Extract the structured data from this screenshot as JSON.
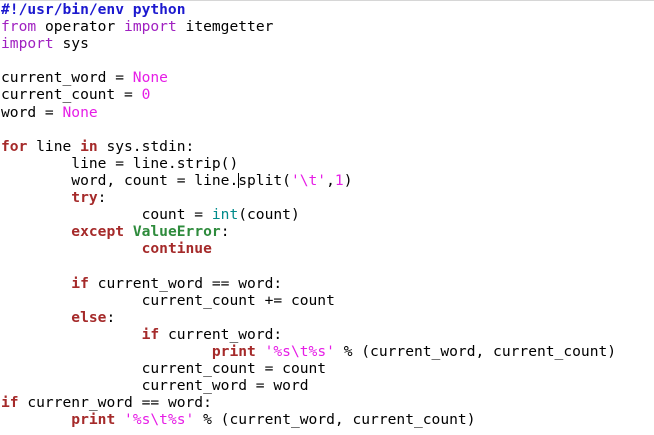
{
  "editor": {
    "lines": [
      [
        {
          "t": "#!/usr/bin/env python",
          "c": "shebang"
        }
      ],
      [
        {
          "t": "from",
          "c": "preproc"
        },
        {
          "t": " operator ",
          "c": "plain"
        },
        {
          "t": "import",
          "c": "preproc"
        },
        {
          "t": " itemgetter",
          "c": "plain"
        }
      ],
      [
        {
          "t": "import",
          "c": "preproc"
        },
        {
          "t": " sys",
          "c": "plain"
        }
      ],
      [],
      [
        {
          "t": "current_word = ",
          "c": "plain"
        },
        {
          "t": "None",
          "c": "const"
        }
      ],
      [
        {
          "t": "current_count = ",
          "c": "plain"
        },
        {
          "t": "0",
          "c": "const"
        }
      ],
      [
        {
          "t": "word = ",
          "c": "plain"
        },
        {
          "t": "None",
          "c": "const"
        }
      ],
      [],
      [
        {
          "t": "for",
          "c": "kw"
        },
        {
          "t": " line ",
          "c": "plain"
        },
        {
          "t": "in",
          "c": "kw"
        },
        {
          "t": " sys.stdin:",
          "c": "plain"
        }
      ],
      [
        {
          "t": "        line = line.strip()",
          "c": "plain"
        }
      ],
      [
        {
          "t": "        word, count = line.",
          "c": "plain"
        },
        {
          "t": "",
          "c": "cursor"
        },
        {
          "t": "split(",
          "c": "plain"
        },
        {
          "t": "'\\t'",
          "c": "const"
        },
        {
          "t": ",",
          "c": "plain"
        },
        {
          "t": "1",
          "c": "const"
        },
        {
          "t": ")",
          "c": "plain"
        }
      ],
      [
        {
          "t": "        ",
          "c": "plain"
        },
        {
          "t": "try",
          "c": "kw"
        },
        {
          "t": ":",
          "c": "plain"
        }
      ],
      [
        {
          "t": "                count = ",
          "c": "plain"
        },
        {
          "t": "int",
          "c": "builtin"
        },
        {
          "t": "(count)",
          "c": "plain"
        }
      ],
      [
        {
          "t": "        ",
          "c": "plain"
        },
        {
          "t": "except",
          "c": "kw"
        },
        {
          "t": " ",
          "c": "plain"
        },
        {
          "t": "ValueError",
          "c": "exc"
        },
        {
          "t": ":",
          "c": "plain"
        }
      ],
      [
        {
          "t": "                ",
          "c": "plain"
        },
        {
          "t": "continue",
          "c": "kw"
        }
      ],
      [],
      [
        {
          "t": "        ",
          "c": "plain"
        },
        {
          "t": "if",
          "c": "kw"
        },
        {
          "t": " current_word == word:",
          "c": "plain"
        }
      ],
      [
        {
          "t": "                current_count += count",
          "c": "plain"
        }
      ],
      [
        {
          "t": "        ",
          "c": "plain"
        },
        {
          "t": "else",
          "c": "kw"
        },
        {
          "t": ":",
          "c": "plain"
        }
      ],
      [
        {
          "t": "                ",
          "c": "plain"
        },
        {
          "t": "if",
          "c": "kw"
        },
        {
          "t": " current_word:",
          "c": "plain"
        }
      ],
      [
        {
          "t": "                        ",
          "c": "plain"
        },
        {
          "t": "print",
          "c": "kw"
        },
        {
          "t": " ",
          "c": "plain"
        },
        {
          "t": "'%s\\t%s'",
          "c": "const"
        },
        {
          "t": " % (current_word, current_count)",
          "c": "plain"
        }
      ],
      [
        {
          "t": "                current_count = count",
          "c": "plain"
        }
      ],
      [
        {
          "t": "                current_word = word",
          "c": "plain"
        }
      ],
      [
        {
          "t": "if",
          "c": "kw"
        },
        {
          "t": " currenr_word == word:",
          "c": "plain"
        }
      ],
      [
        {
          "t": "        ",
          "c": "plain"
        },
        {
          "t": "print",
          "c": "kw"
        },
        {
          "t": " ",
          "c": "plain"
        },
        {
          "t": "'%s\\t%s'",
          "c": "const"
        },
        {
          "t": " % (current_word, current_count)",
          "c": "plain"
        }
      ]
    ],
    "colors": {
      "background": "#ffffff",
      "plain": "#000000",
      "shebang": "#1c19cf",
      "preproc": "#a021c1",
      "const": "#e61de6",
      "keyword": "#a52a2a",
      "builtin": "#008b8b",
      "exception": "#2e8b3c"
    }
  }
}
